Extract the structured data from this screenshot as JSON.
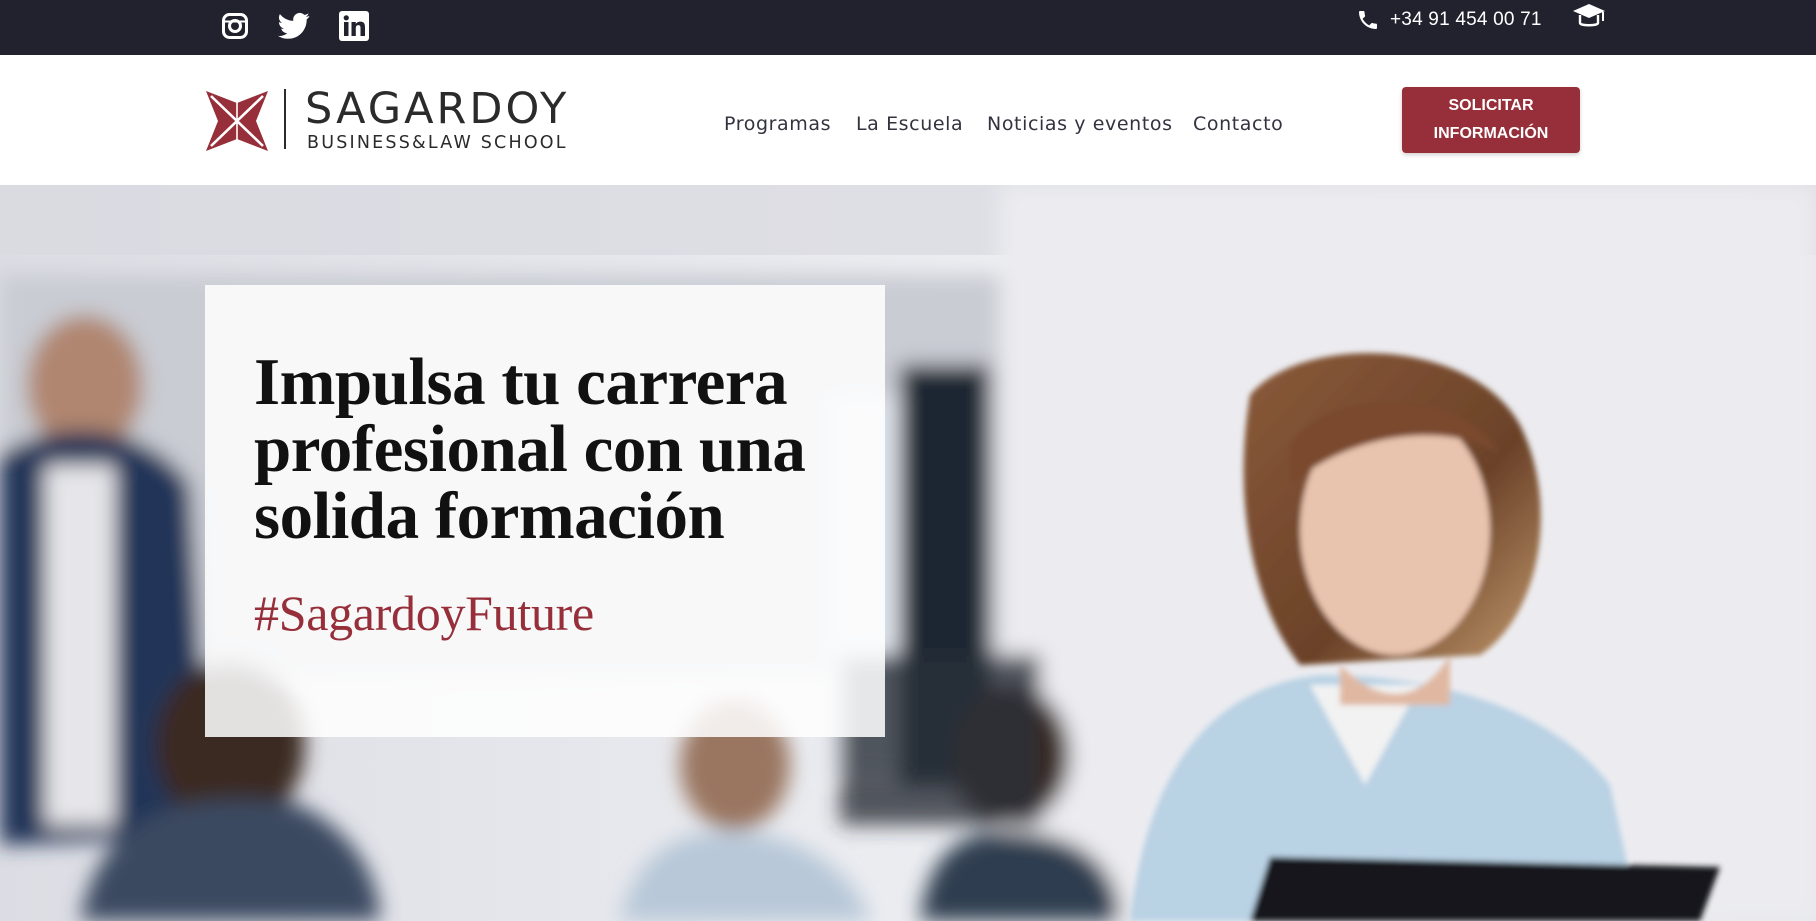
{
  "topbar": {
    "social": [
      {
        "name": "instagram-icon"
      },
      {
        "name": "twitter-icon"
      },
      {
        "name": "linkedin-icon"
      }
    ],
    "phone": "+34 91 454 00 71",
    "phone_icon": "phone-icon",
    "campus_icon": "graduation-cap-icon"
  },
  "header": {
    "logo": {
      "name": "SAGARDOY",
      "subtitle": "BUSINESS&LAW SCHOOL"
    },
    "nav": [
      {
        "label": "Programas"
      },
      {
        "label": "La Escuela"
      },
      {
        "label": "Noticias y eventos"
      },
      {
        "label": "Contacto"
      }
    ],
    "cta_line1": "SOLICITAR",
    "cta_line2": "INFORMACIÓN"
  },
  "hero": {
    "title": "Impulsa tu carrera profesional con una solida formación",
    "tag": "#SagardoyFuture"
  },
  "colors": {
    "topbar_bg": "#22222f",
    "brand": "#962f3a",
    "nav_text": "#333340"
  }
}
